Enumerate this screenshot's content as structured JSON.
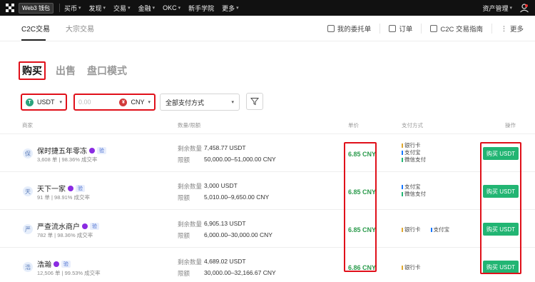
{
  "topnav": {
    "web3_label": "Web3 钱包",
    "items": [
      "买币",
      "发现",
      "交易",
      "金融",
      "OKC",
      "新手学院",
      "更多"
    ],
    "right": [
      "资产管理"
    ]
  },
  "subnav": {
    "tabs": [
      "C2C交易",
      "大宗交易"
    ],
    "links": [
      "我的委托单",
      "订单",
      "C2C 交易指南",
      "更多"
    ]
  },
  "modes": [
    "购买",
    "出售",
    "盘口模式"
  ],
  "filters": {
    "coin": "USDT",
    "amount_placeholder": "0.00",
    "fiat": "CNY",
    "payment": "全部支付方式"
  },
  "table": {
    "headers": [
      "商家",
      "数量/限额",
      "单价",
      "支付方式",
      "操作"
    ],
    "qty_label": "剩余数量",
    "limit_label": "限额",
    "buy_label": "购买 USDT",
    "verify_tag": "验",
    "rows": [
      {
        "avatar": "保",
        "name": "保时捷五年零冻",
        "stats": "3,608 单 | 98.36% 成交率",
        "qty": "7,458.77 USDT",
        "limit": "50,000.00–51,000.00 CNY",
        "price": "6.85 CNY",
        "payments": [
          "银行卡",
          "支付宝",
          "微信支付"
        ]
      },
      {
        "avatar": "天",
        "name": "天下一家",
        "stats": "91 单 | 98.91% 成交率",
        "qty": "3,000 USDT",
        "limit": "5,010.00–9,650.00 CNY",
        "price": "6.85 CNY",
        "payments": [
          "支付宝",
          "微信支付"
        ]
      },
      {
        "avatar": "严",
        "name": "严查流水商户",
        "stats": "782 单 | 98.36% 成交率",
        "qty": "6,905.13 USDT",
        "limit": "6,000.00–30,000.00 CNY",
        "price": "6.85 CNY",
        "payments": [
          "银行卡",
          "支付宝"
        ]
      },
      {
        "avatar": "浩",
        "name": "浩瀚",
        "stats": "12,506 单 | 99.53% 成交率",
        "qty": "4,689.02 USDT",
        "limit": "30,000.00–32,166.67 CNY",
        "price": "6.86 CNY",
        "payments": [
          "银行卡"
        ]
      }
    ]
  },
  "colors": {
    "accent_green": "#22b573",
    "price_green": "#2a9a4b",
    "highlight_red": "#e0101a"
  }
}
